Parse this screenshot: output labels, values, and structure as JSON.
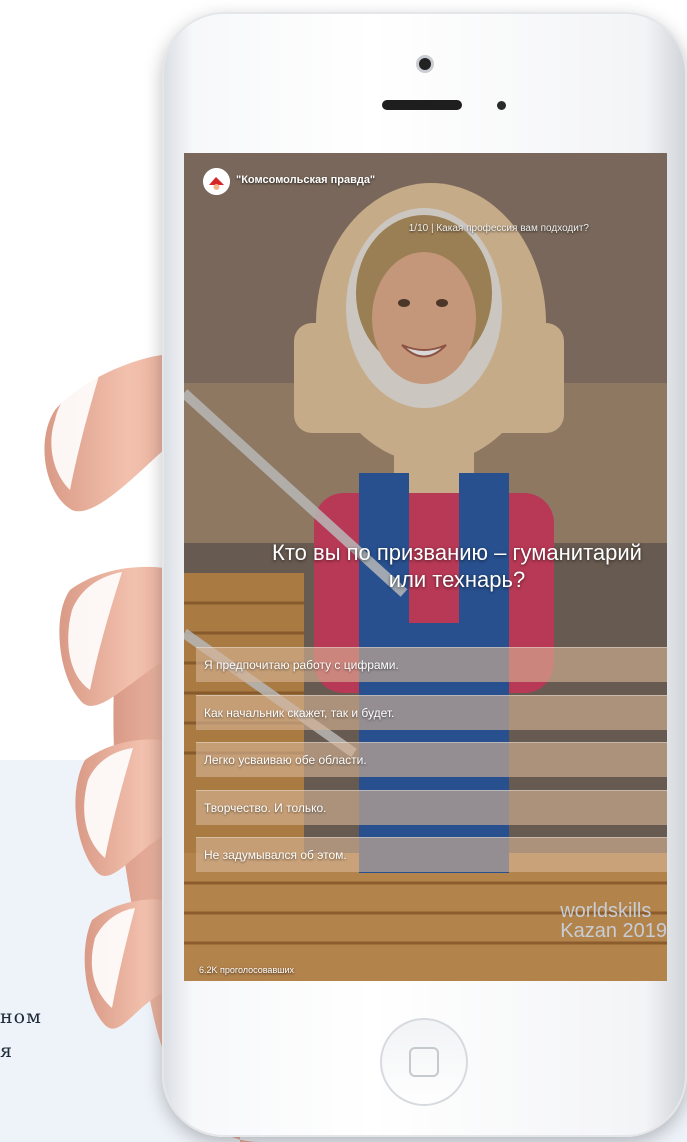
{
  "background": {
    "caption_line1": "ном",
    "caption_line2": "я"
  },
  "story": {
    "source": "\"Комсомольская правда\"",
    "progress": "1/10 | Какая профессия вам подходит?",
    "question": "Кто вы по призванию – гуманитарий или технарь?",
    "answers": [
      "Я предпочитаю работу с цифрами.",
      "Как начальник скажет, так и будет.",
      "Легко усваиваю обе области.",
      "Творчество. И только.",
      "Не задумывался об этом."
    ],
    "votes": "6.2K проголосовавших",
    "watermark_line1": "worldskills",
    "watermark_line2": "Kazan 2019"
  },
  "colors": {
    "answer_bg": "#d6b496",
    "page_bg": "#ffffff",
    "panel_bg": "#eef3f9"
  },
  "icons": [
    "komsomolskaya-pravda-logo-icon",
    "worldskills-logo-icon"
  ]
}
